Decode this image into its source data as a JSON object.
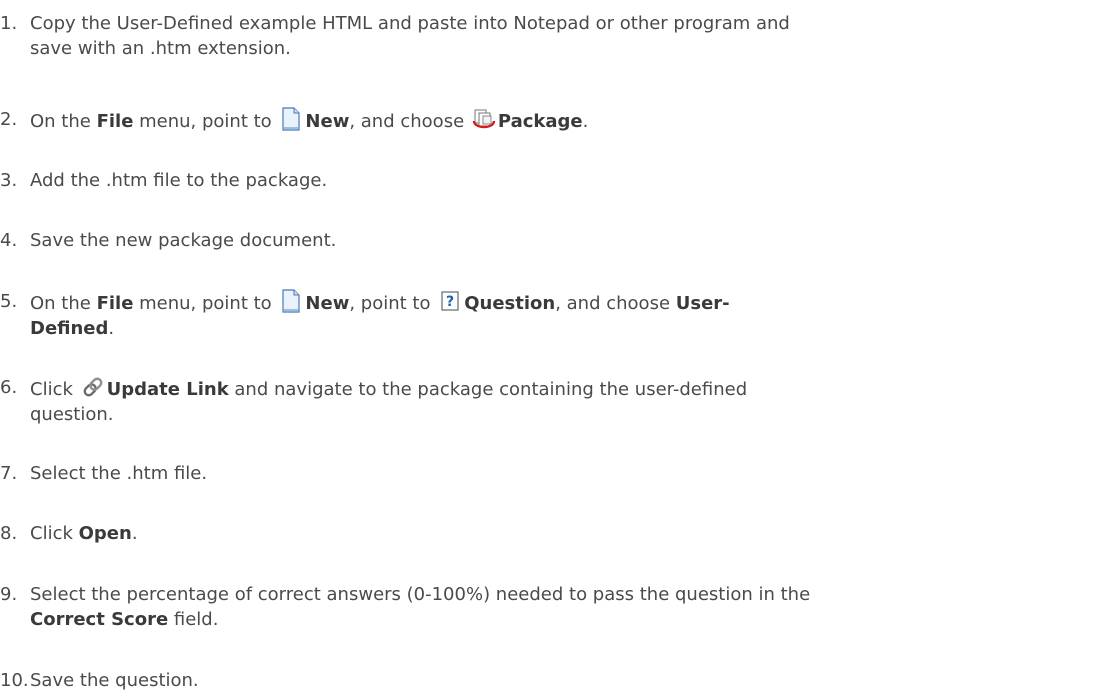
{
  "steps": [
    {
      "num": "1.",
      "line1": "Copy the User-Defined example HTML and paste into Notepad or other program and",
      "line2": "save with an .htm extension."
    },
    {
      "num": "2.",
      "pre": "On the ",
      "bold1": "File",
      "mid1": " menu, point to ",
      "icon1": "new-document-icon",
      "bold2": "New",
      "mid2": ", and choose ",
      "icon2": "package-icon",
      "bold3": "Package",
      "post": "."
    },
    {
      "num": "3.",
      "text": "Add the .htm file to the package."
    },
    {
      "num": "4.",
      "text": "Save the new package document."
    },
    {
      "num": "5.",
      "pre": "On the ",
      "bold1": "File",
      "mid1": " menu, point to ",
      "icon1": "new-document-icon",
      "bold2": "New",
      "mid2": ", point to ",
      "icon2": "question-icon",
      "bold3": "Question",
      "mid3": ", and choose ",
      "bold4a": "User-",
      "bold4b": "Defined",
      "post": "."
    },
    {
      "num": "6.",
      "pre": "Click ",
      "icon1": "link-icon",
      "bold1": "Update Link",
      "line1_post": " and navigate to the package containing the user-defined",
      "line2": "question."
    },
    {
      "num": "7.",
      "text": "Select the .htm file."
    },
    {
      "num": "8.",
      "pre": "Click ",
      "bold1": "Open",
      "post": "."
    },
    {
      "num": "9.",
      "line1": "Select the percentage of correct answers (0-100%) needed to pass the question in the",
      "bold1": "Correct Score",
      "post": " field."
    },
    {
      "num": "10.",
      "text": "Save the question."
    }
  ]
}
